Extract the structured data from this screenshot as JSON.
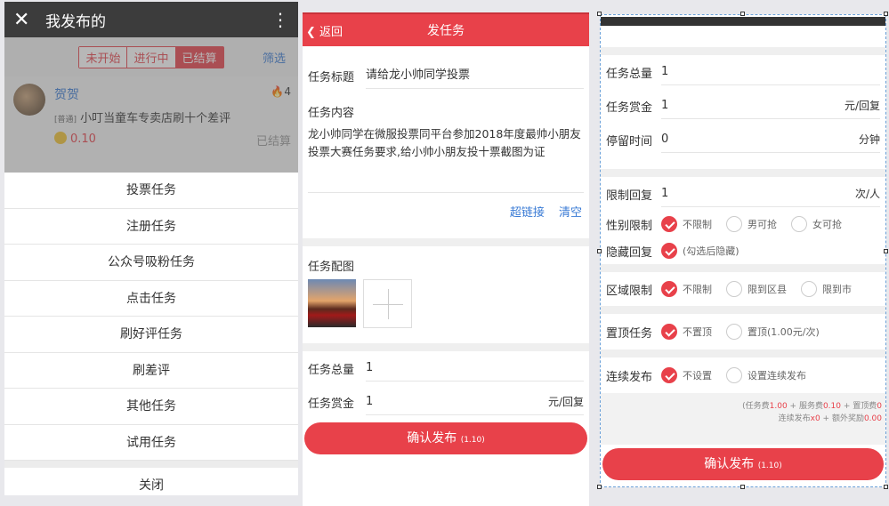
{
  "p1": {
    "header_title": "我发布的",
    "tabs": [
      "未开始",
      "进行中",
      "已结算"
    ],
    "filter": "筛选",
    "card": {
      "name": "贺贺",
      "fire_count": "4",
      "tag": "[普通]",
      "desc": "小叮当童车专卖店刷十个差评",
      "amount": "0.10",
      "state": "已结算"
    },
    "menu": [
      "投票任务",
      "注册任务",
      "公众号吸粉任务",
      "点击任务",
      "刷好评任务",
      "刷差评",
      "其他任务",
      "试用任务"
    ],
    "close": "关闭"
  },
  "p2": {
    "back": "返回",
    "title": "发任务",
    "task_title_label": "任务标题",
    "task_title_value": "请给龙小帅同学投票",
    "content_label": "任务内容",
    "content_text": "龙小帅同学在微服投票同平台参加2018年度最帅小朋友投票大赛任务要求,给小帅小朋友投十票截图为证",
    "link_btn": "超链接",
    "clear_btn": "清空",
    "img_label": "任务配图",
    "total_label": "任务总量",
    "total_value": "1",
    "reward_label": "任务赏金",
    "reward_value": "1",
    "reward_unit": "元/回复",
    "confirm": "确认发布",
    "confirm_fee": "(1.10)"
  },
  "p3": {
    "total_label": "任务总量",
    "total_value": "1",
    "reward_label": "任务赏金",
    "reward_value": "1",
    "reward_unit": "元/回复",
    "stay_label": "停留时间",
    "stay_value": "0",
    "stay_unit": "分钟",
    "limit_label": "限制回复",
    "limit_value": "1",
    "limit_unit": "次/人",
    "gender_label": "性别限制",
    "gender_opts": [
      "不限制",
      "男可抢",
      "女可抢"
    ],
    "hide_label": "隐藏回复",
    "hide_opt": "(勾选后隐藏)",
    "region_label": "区域限制",
    "region_opts": [
      "不限制",
      "限到区县",
      "限到市"
    ],
    "top_label": "置顶任务",
    "top_opts": [
      "不置顶",
      "置顶(1.00元/次)"
    ],
    "cont_label": "连续发布",
    "cont_opts": [
      "不设置",
      "设置连续发布"
    ],
    "fee_line1_a": "(任务费",
    "fee_line1_b": "1.00",
    "fee_line1_c": " + 服务费",
    "fee_line1_d": "0.10",
    "fee_line1_e": " + 置顶费",
    "fee_line1_f": "0",
    "fee_line2_a": "连续发布",
    "fee_line2_b": "x0",
    "fee_line2_c": " + 额外奖励",
    "fee_line2_d": "0.00",
    "confirm": "确认发布",
    "confirm_fee": "(1.10)"
  },
  "colors": {
    "accent": "#e8414a",
    "link": "#3a7bd5"
  }
}
